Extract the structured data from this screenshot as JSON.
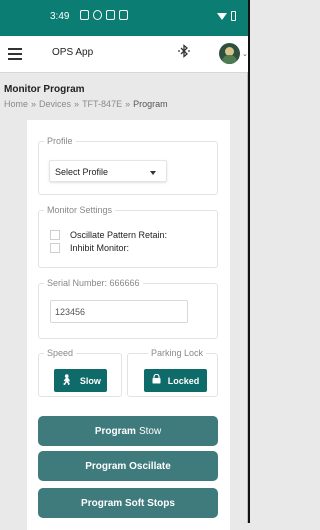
{
  "status_bar": {
    "time": "3:49"
  },
  "app_bar": {
    "title": "OPS App"
  },
  "page": {
    "title": "Monitor Program"
  },
  "breadcrumb": {
    "home": "Home",
    "devices": "Devices",
    "device": "TFT-847E",
    "current": "Program",
    "separator": "»"
  },
  "profile": {
    "legend": "Profile",
    "select_value": "Select Profile"
  },
  "monitor_settings": {
    "legend": "Monitor Settings",
    "options": [
      {
        "label": "Oscillate Pattern Retain:",
        "checked": false
      },
      {
        "label": "Inhibit Monitor:",
        "checked": false
      }
    ]
  },
  "serial": {
    "legend": "Serial Number: 666666",
    "value": "123456"
  },
  "speed": {
    "legend": "Speed",
    "button_label": "Slow"
  },
  "parking_lock": {
    "legend": "Parking Lock",
    "button_label": "Locked"
  },
  "actions": {
    "stow_bold": "Program",
    "stow_light": "Stow",
    "oscillate": "Program Oscillate",
    "soft_stops": "Program Soft Stops"
  },
  "colors": {
    "status_bar": "#0b7d72",
    "pill_button": "#0f6a6a",
    "action_button": "#3f7b7d"
  },
  "icons": [
    "hamburger-menu-icon",
    "bluetooth-icon",
    "avatar",
    "walking-person-icon",
    "lock-icon"
  ]
}
